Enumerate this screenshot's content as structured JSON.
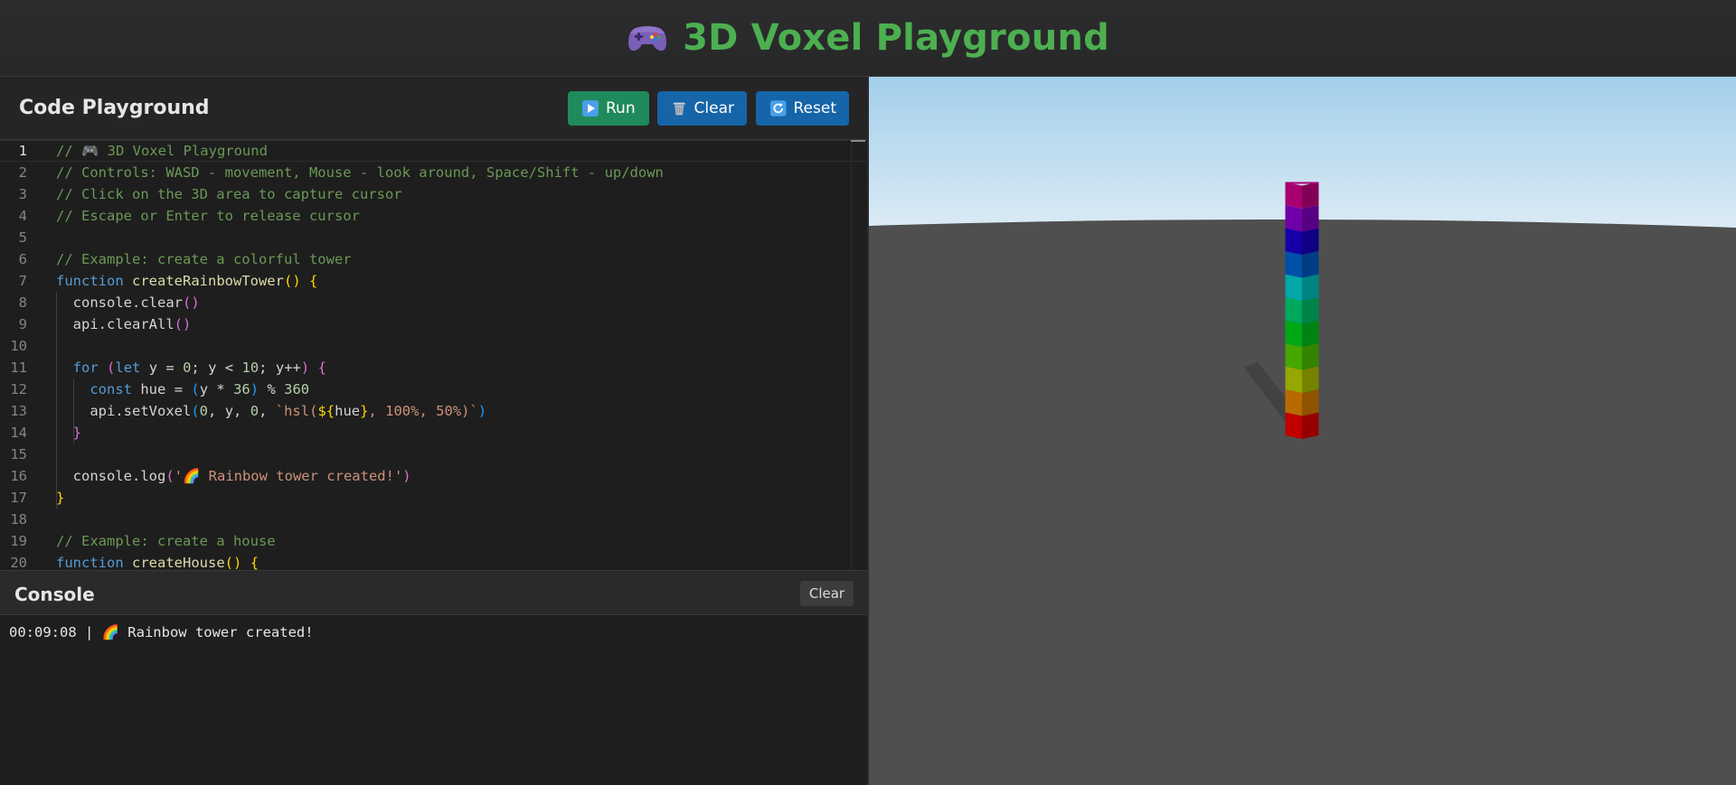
{
  "app": {
    "title": "3D Voxel Playground",
    "accent": "#4caf50"
  },
  "playground": {
    "title": "Code Playground",
    "buttons": {
      "run": "Run",
      "clear": "Clear",
      "reset": "Reset"
    },
    "active_line": 1
  },
  "editor": {
    "lines": [
      "// 🎮 3D Voxel Playground",
      "// Controls: WASD - movement, Mouse - look around, Space/Shift - up/down",
      "// Click on the 3D area to capture cursor",
      "// Escape or Enter to release cursor",
      "",
      "// Example: create a colorful tower",
      "function createRainbowTower() {",
      "  console.clear()",
      "  api.clearAll()",
      "",
      "  for (let y = 0; y < 10; y++) {",
      "    const hue = (y * 36) % 360",
      "    api.setVoxel(0, y, 0, `hsl(${hue}, 100%, 50%)`)",
      "  }",
      "",
      "  console.log('🌈 Rainbow tower created!')",
      "}",
      "",
      "// Example: create a house",
      "function createHouse() {"
    ]
  },
  "console": {
    "title": "Console",
    "clear_label": "Clear",
    "entries": [
      {
        "time": "00:09:08",
        "message": "🌈 Rainbow tower created!"
      }
    ]
  },
  "scene": {
    "sky_top": "#a3cfeb",
    "sky_bottom": "#dcebf5",
    "ground": "#4f4f4f",
    "tower_colors": [
      "#c00000",
      "#b86a00",
      "#96a800",
      "#44a800",
      "#00a818",
      "#00a85e",
      "#00a8a8",
      "#0050a8",
      "#1500a8",
      "#7000a8",
      "#a80070"
    ]
  }
}
